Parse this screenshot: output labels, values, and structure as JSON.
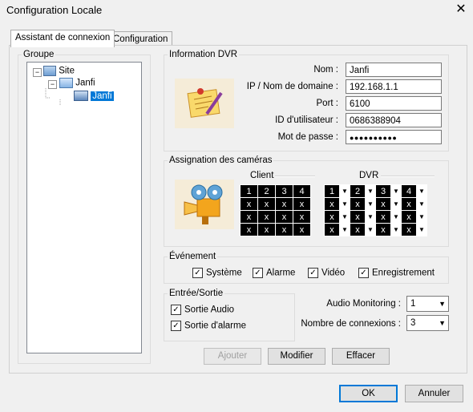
{
  "window": {
    "title": "Configuration Locale",
    "close_label": "✕"
  },
  "tabs": [
    {
      "label": "Assistant de connexion"
    },
    {
      "label": "Configuration"
    }
  ],
  "groupe": {
    "legend": "Groupe",
    "tree": {
      "root": "Site",
      "child": "Janfi",
      "leaf": "Janfi",
      "expander": "−"
    }
  },
  "info_dvr": {
    "legend": "Information DVR",
    "fields": [
      {
        "label": "Nom :",
        "value": "Janfi"
      },
      {
        "label": "IP / Nom de domaine :",
        "value": "192.168.1.1"
      },
      {
        "label": "Port :",
        "value": "6100"
      },
      {
        "label": "ID d'utilisateur :",
        "value": "0686388904"
      },
      {
        "label": "Mot de passe :",
        "value": "●●●●●●●●●●"
      }
    ]
  },
  "assignation": {
    "legend": "Assignation des caméras",
    "client_header": "Client",
    "dvr_header": "DVR",
    "client_rows": [
      [
        "1",
        "2",
        "3",
        "4"
      ],
      [
        "x",
        "x",
        "x",
        "x"
      ],
      [
        "x",
        "x",
        "x",
        "x"
      ],
      [
        "x",
        "x",
        "x",
        "x"
      ]
    ],
    "dvr_rows": [
      [
        "1",
        "2",
        "3",
        "4"
      ],
      [
        "x",
        "x",
        "x",
        "x"
      ],
      [
        "x",
        "x",
        "x",
        "x"
      ],
      [
        "x",
        "x",
        "x",
        "x"
      ]
    ],
    "arrow": "▼"
  },
  "evenement": {
    "legend": "Événement",
    "items": [
      {
        "label": "Système",
        "checked": true
      },
      {
        "label": "Alarme",
        "checked": true
      },
      {
        "label": "Vidéo",
        "checked": true
      },
      {
        "label": "Enregistrement",
        "checked": true
      }
    ],
    "check_mark": "✓"
  },
  "entree_sortie": {
    "legend": "Entrée/Sortie",
    "items": [
      {
        "label": "Sortie Audio",
        "checked": true
      },
      {
        "label": "Sortie d'alarme",
        "checked": true
      }
    ]
  },
  "audio_monitoring": {
    "label": "Audio Monitoring :",
    "value": "1"
  },
  "nombre_connexions": {
    "label": "Nombre de connexions :",
    "value": "3"
  },
  "actions": {
    "ajouter": "Ajouter",
    "modifier": "Modifier",
    "effacer": "Effacer"
  },
  "footer": {
    "ok": "OK",
    "annuler": "Annuler"
  }
}
